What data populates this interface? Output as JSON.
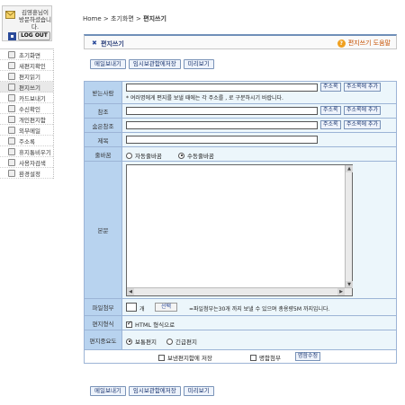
{
  "user": {
    "greeting_line1": "김영훈님이",
    "greeting_line2": "방문하셨습니다.",
    "logout_label": "LOG OUT"
  },
  "sidebar": {
    "items": [
      {
        "label": "초기화면",
        "icon": "home-icon"
      },
      {
        "label": "새편지확인",
        "icon": "new-mail-icon"
      },
      {
        "label": "편지읽기",
        "icon": "read-mail-icon"
      },
      {
        "label": "편지쓰기",
        "icon": "write-mail-icon",
        "active": true
      },
      {
        "label": "카드보내기",
        "icon": "card-icon"
      },
      {
        "label": "수신확인",
        "icon": "receipt-icon"
      },
      {
        "label": "개인편지함",
        "icon": "folder-icon"
      },
      {
        "label": "외부메일",
        "icon": "external-mail-icon"
      },
      {
        "label": "주소록",
        "icon": "addressbook-icon"
      },
      {
        "label": "휴지통비우기",
        "icon": "trash-icon"
      },
      {
        "label": "사용자검색",
        "icon": "user-search-icon"
      },
      {
        "label": "환경설정",
        "icon": "settings-icon"
      }
    ]
  },
  "breadcrumb": {
    "home": "Home",
    "sep": ">",
    "parent": "초기화면",
    "current": "편지쓰기"
  },
  "page": {
    "title": "편지쓰기",
    "help_label": "편지쓰기 도움말"
  },
  "toolbar": {
    "send": "메일보내기",
    "save_draft": "임시보관함에저장",
    "preview": "미리보기"
  },
  "form": {
    "to_label": "받는사람",
    "to_note": "* 여러명에게 편지를 보낼 때에는 각 주소를 , 로 구분하시기 바랍니다.",
    "cc_label": "참조",
    "bcc_label": "숨은참조",
    "subject_label": "제목",
    "addressbook_btn": "주소록",
    "add_to_addressbook_btn": "주소록에 추가",
    "sig_label": "줄바꿈",
    "sig_auto": "자동줄바꿈",
    "sig_manual": "수동줄바꿈",
    "body_label": "본문",
    "attach_label": "파일첨부",
    "attach_count": "개",
    "attach_select": "선택",
    "attach_note": "=파일첨부는30개 까지 보낼 수 있으며 총용량5M 까지입니다.",
    "format_label": "편지형식",
    "format_html": "HTML 형식으로",
    "priority_label": "편지중요도",
    "priority_normal": "보통편지",
    "priority_urgent": "긴급편지",
    "save_sent": "보낸편지함에 저장",
    "namecard": "명함첨부",
    "namecard_edit": "명함수정"
  }
}
